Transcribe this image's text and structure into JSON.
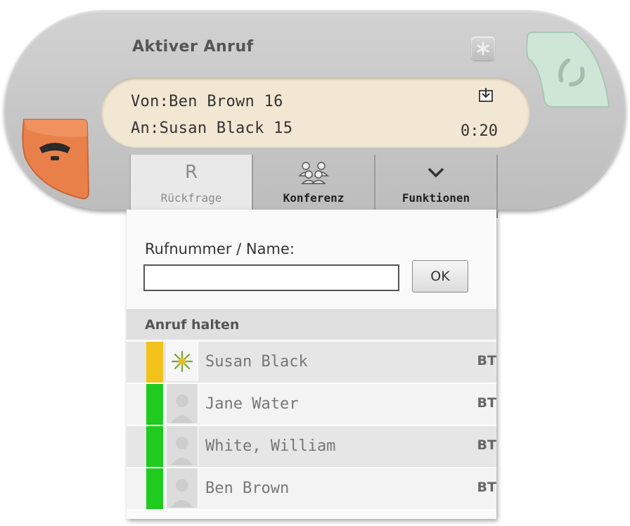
{
  "window": {
    "title": "Aktiver Anruf"
  },
  "call": {
    "from": "Von:Ben Brown 16",
    "to": "An:Susan Black 15",
    "duration": "0:20"
  },
  "toolbar": {
    "items": [
      {
        "glyph": "R",
        "label": "Rückfrage",
        "state": "disabled"
      },
      {
        "icon": "conference-icon",
        "label": "Konferenz",
        "state": "active"
      },
      {
        "icon": "chevron-down-icon",
        "label": "Funktionen",
        "state": "active"
      }
    ]
  },
  "consult": {
    "label": "Rufnummer / Name:",
    "input_value": "",
    "ok_label": "OK"
  },
  "hold": {
    "header": "Anruf halten",
    "rows": [
      {
        "name": "Susan Black",
        "tag": "BT",
        "status_color": "#f2c21b",
        "avatar": "busy-icon"
      },
      {
        "name": "Jane Water",
        "tag": "BT",
        "status_color": "#1fcb1f",
        "avatar": "avatar-icon"
      },
      {
        "name": "White, William",
        "tag": "BT",
        "status_color": "#1fcb1f",
        "avatar": "avatar-icon"
      },
      {
        "name": "Ben Brown",
        "tag": "BT",
        "status_color": "#1fcb1f",
        "avatar": "avatar-icon"
      }
    ]
  },
  "colors": {
    "hangup": "#e9804a",
    "answer": "#cfe6d6",
    "info_bg": "#f2e7d3"
  }
}
